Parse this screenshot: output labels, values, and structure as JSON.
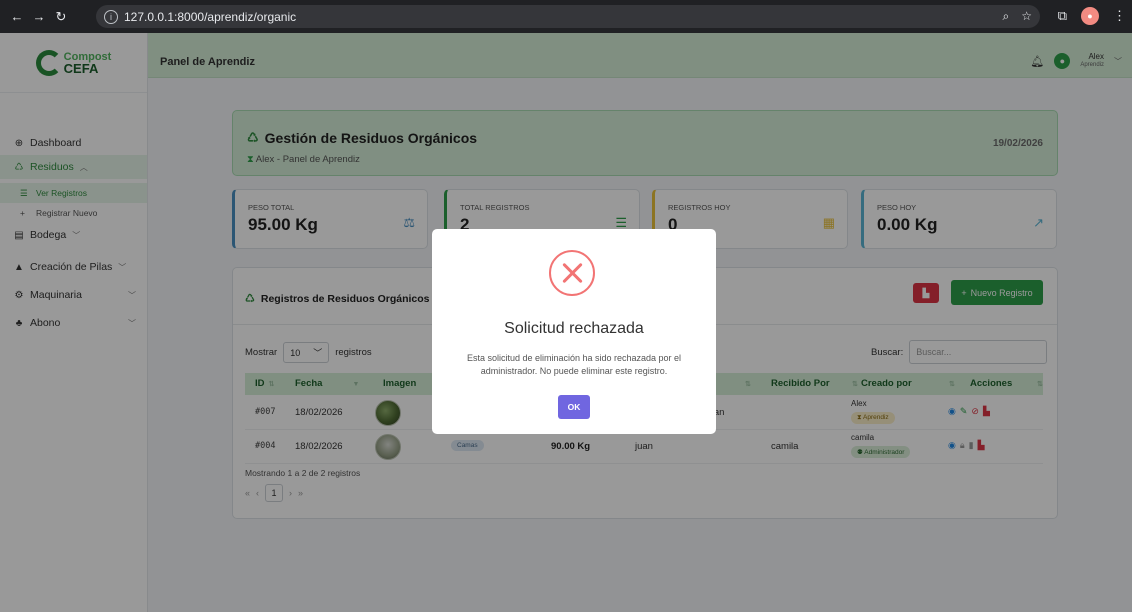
{
  "browser": {
    "url": "127.0.0.1:8000/aprendiz/organic"
  },
  "logo": {
    "line1": "Compost",
    "line2": "CEFA"
  },
  "sidebar": {
    "items": [
      {
        "label": "Dashboard",
        "icon": "dashboard-icon"
      },
      {
        "label": "Residuos",
        "icon": "recycle-icon"
      },
      {
        "label": "Ver Registros",
        "icon": "list-icon"
      },
      {
        "label": "Registrar Nuevo",
        "icon": "plus-icon"
      },
      {
        "label": "Bodega",
        "icon": "warehouse-icon"
      },
      {
        "label": "Creación de Pilas",
        "icon": "triangle-icon"
      },
      {
        "label": "Maquinaria",
        "icon": "gears-icon"
      },
      {
        "label": "Abono",
        "icon": "seedling-icon"
      }
    ]
  },
  "topbar": {
    "title": "Panel de Aprendiz",
    "user_name": "Alex",
    "user_role": "Aprendiz"
  },
  "header": {
    "title": "Gestión de Residuos Orgánicos",
    "subtitle": "Alex - Panel de Aprendiz",
    "date": "19/02/2026"
  },
  "stats": [
    {
      "label": "PESO TOTAL",
      "value": "95.00 Kg",
      "color": "#4a90c2"
    },
    {
      "label": "TOTAL REGISTROS",
      "value": "2",
      "color": "#2e9e4a"
    },
    {
      "label": "REGISTROS HOY",
      "value": "0",
      "color": "#e9c13a"
    },
    {
      "label": "PESO HOY",
      "value": "0.00 Kg",
      "color": "#5ab4d4"
    }
  ],
  "table": {
    "title": "Registros de Residuos Orgánicos",
    "new_button": "Nuevo Registro",
    "show_label": "Mostrar",
    "show_value": "10",
    "records_label": "registros",
    "search_label": "Buscar:",
    "search_placeholder": "Buscar...",
    "columns": [
      "ID",
      "Fecha",
      "Imagen",
      "Recibido Por",
      "Creado por",
      "Acciones"
    ],
    "rows": [
      {
        "id": "#007",
        "fecha": "18/02/2026",
        "tipo": "",
        "peso": "",
        "entregado": "",
        "recibido": "ivan",
        "creado": "Alex",
        "rol": "Aprendiz"
      },
      {
        "id": "#004",
        "fecha": "18/02/2026",
        "tipo": "Camas",
        "peso": "90.00 Kg",
        "entregado": "juan",
        "recibido": "camila",
        "creado": "camila",
        "rol": "Administrador"
      }
    ],
    "footer": "Mostrando 1 a 2 de 2 registros",
    "page": "1"
  },
  "modal": {
    "title": "Solicitud rechazada",
    "text": "Esta solicitud de eliminación ha sido rechazada por el administrador. No puede eliminar este registro.",
    "ok": "OK"
  }
}
